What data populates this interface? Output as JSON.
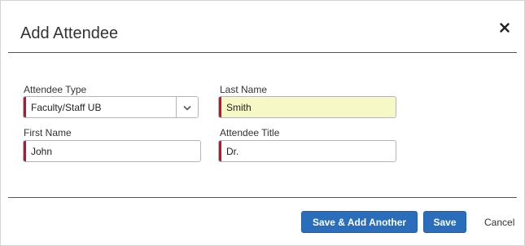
{
  "dialog": {
    "title": "Add Attendee",
    "close_icon": "close-icon",
    "close_glyph": "✕"
  },
  "form": {
    "attendee_type": {
      "label": "Attendee Type",
      "value": "Faculty/Staff UB",
      "icon": "chevron-down-icon"
    },
    "last_name": {
      "label": "Last Name",
      "value": "Smith",
      "highlight_color": "#f6f9c6"
    },
    "first_name": {
      "label": "First Name",
      "value": "John"
    },
    "attendee_title": {
      "label": "Attendee Title",
      "value": "Dr."
    },
    "required_marker_color": "#c8102e"
  },
  "footer": {
    "save_add_another_label": "Save & Add Another",
    "save_label": "Save",
    "cancel_label": "Cancel",
    "primary_color": "#2a6ebb"
  }
}
